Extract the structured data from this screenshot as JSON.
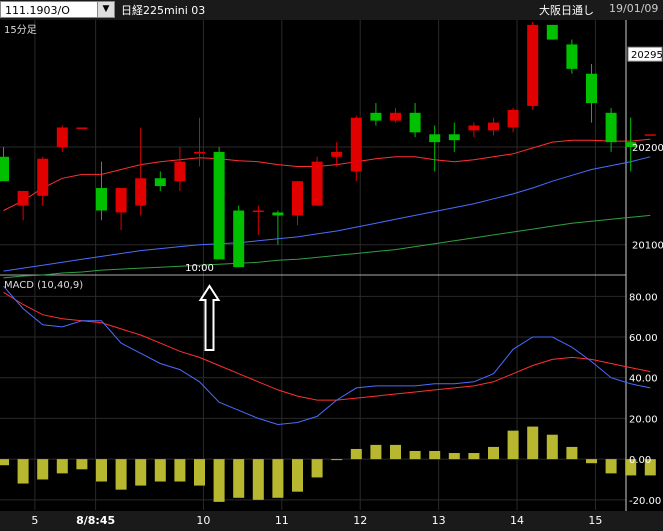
{
  "toolbar": {
    "symbol": "111.1903/O",
    "dropdown_glyph": "▼",
    "contract": "日経225mini 03",
    "market": "大阪日通し",
    "date": "19/01/09"
  },
  "chart_data": [
    {
      "type": "candlestick",
      "title": "15分足",
      "ylim": [
        20070,
        20330
      ],
      "yticks": [
        20100,
        20200
      ],
      "last_price_label": "20295",
      "annotation": {
        "label": "10:00",
        "arrow": "up",
        "candle_index": 10
      },
      "colors": {
        "up": "#e00000",
        "down": "#00c000",
        "ma_short": "#ff3030",
        "ma_mid": "#4a6cff",
        "ma_long": "#30a040"
      },
      "candles": [
        {
          "o": 20190,
          "h": 20200,
          "l": 20165,
          "c": 20165
        },
        {
          "o": 20140,
          "h": 20155,
          "l": 20125,
          "c": 20155
        },
        {
          "o": 20150,
          "h": 20190,
          "l": 20140,
          "c": 20188
        },
        {
          "o": 20200,
          "h": 20222,
          "l": 20195,
          "c": 20220
        },
        {
          "o": 20220,
          "h": 20220,
          "l": 20220,
          "c": 20220
        },
        {
          "o": 20158,
          "h": 20185,
          "l": 20125,
          "c": 20135
        },
        {
          "o": 20133,
          "h": 20155,
          "l": 20115,
          "c": 20158
        },
        {
          "o": 20140,
          "h": 20220,
          "l": 20130,
          "c": 20168
        },
        {
          "o": 20168,
          "h": 20175,
          "l": 20155,
          "c": 20160
        },
        {
          "o": 20165,
          "h": 20200,
          "l": 20155,
          "c": 20185
        },
        {
          "o": 20195,
          "h": 20230,
          "l": 20180,
          "c": 20195
        },
        {
          "o": 20195,
          "h": 20200,
          "l": 20085,
          "c": 20085
        },
        {
          "o": 20135,
          "h": 20140,
          "l": 20080,
          "c": 20077
        },
        {
          "o": 20135,
          "h": 20140,
          "l": 20110,
          "c": 20135
        },
        {
          "o": 20133,
          "h": 20135,
          "l": 20100,
          "c": 20130
        },
        {
          "o": 20130,
          "h": 20165,
          "l": 20120,
          "c": 20165
        },
        {
          "o": 20140,
          "h": 20190,
          "l": 20140,
          "c": 20185
        },
        {
          "o": 20190,
          "h": 20205,
          "l": 20180,
          "c": 20195
        },
        {
          "o": 20175,
          "h": 20232,
          "l": 20165,
          "c": 20230
        },
        {
          "o": 20235,
          "h": 20245,
          "l": 20222,
          "c": 20227
        },
        {
          "o": 20227,
          "h": 20240,
          "l": 20225,
          "c": 20235
        },
        {
          "o": 20235,
          "h": 20245,
          "l": 20210,
          "c": 20215
        },
        {
          "o": 20213,
          "h": 20222,
          "l": 20175,
          "c": 20205
        },
        {
          "o": 20213,
          "h": 20225,
          "l": 20195,
          "c": 20207
        },
        {
          "o": 20217,
          "h": 20225,
          "l": 20210,
          "c": 20222
        },
        {
          "o": 20217,
          "h": 20230,
          "l": 20212,
          "c": 20225
        },
        {
          "o": 20220,
          "h": 20240,
          "l": 20215,
          "c": 20238
        },
        {
          "o": 20242,
          "h": 20328,
          "l": 20238,
          "c": 20325
        },
        {
          "o": 20325,
          "h": 20325,
          "l": 20310,
          "c": 20310
        },
        {
          "o": 20305,
          "h": 20310,
          "l": 20275,
          "c": 20280
        },
        {
          "o": 20275,
          "h": 20285,
          "l": 20225,
          "c": 20245
        },
        {
          "o": 20235,
          "h": 20240,
          "l": 20195,
          "c": 20205
        },
        {
          "o": 20205,
          "h": 20230,
          "l": 20175,
          "c": 20200
        },
        {
          "o": 20213,
          "h": 20213,
          "l": 20213,
          "c": 20213
        }
      ],
      "ma_short": [
        20135,
        20145,
        20158,
        20168,
        20172,
        20172,
        20177,
        20182,
        20185,
        20187,
        20189,
        20188,
        20186,
        20185,
        20182,
        20180,
        20180,
        20182,
        20185,
        20188,
        20190,
        20190,
        20187,
        20185,
        20187,
        20190,
        20193,
        20199,
        20205,
        20207,
        20207,
        20206,
        20206,
        20208
      ],
      "ma_mid": [
        20073,
        20076,
        20079,
        20082,
        20085,
        20088,
        20091,
        20094,
        20096,
        20098,
        20100,
        20101,
        20102,
        20104,
        20106,
        20108,
        20111,
        20114,
        20118,
        20122,
        20126,
        20130,
        20134,
        20138,
        20142,
        20147,
        20152,
        20158,
        20165,
        20171,
        20177,
        20181,
        20185,
        20190
      ],
      "ma_long": [
        20066,
        20068,
        20069,
        20071,
        20072,
        20074,
        20075,
        20076,
        20077,
        20078,
        20079,
        20080,
        20081,
        20082,
        20084,
        20085,
        20087,
        20089,
        20091,
        20093,
        20095,
        20098,
        20101,
        20104,
        20107,
        20110,
        20113,
        20116,
        20119,
        20122,
        20124,
        20126,
        20128,
        20130
      ]
    },
    {
      "type": "macd",
      "title": "MACD (10,40,9)",
      "ylim": [
        -25,
        90
      ],
      "yticks": [
        80,
        60,
        40,
        20,
        0,
        -20
      ],
      "ytick_labels": [
        "80.00",
        "60.00",
        "40.00",
        "20.00",
        "0.00",
        "-20.00"
      ],
      "colors": {
        "macd": "#4a6cff",
        "signal": "#ff3030",
        "histogram": "#b8b830"
      },
      "macd": [
        85,
        74,
        66,
        65,
        68,
        68,
        57,
        52,
        47,
        44,
        38,
        28,
        24,
        20,
        17,
        18,
        21,
        29,
        35,
        36,
        36,
        36,
        37,
        37,
        38,
        42,
        54,
        60,
        60,
        55,
        48,
        40,
        37,
        35
      ],
      "signal": [
        82,
        76,
        71,
        69,
        68,
        67,
        64,
        61,
        57,
        53,
        50,
        46,
        42,
        38,
        34,
        31,
        29,
        29,
        30,
        31,
        32,
        33,
        34,
        35,
        36,
        38,
        42,
        46,
        49,
        50,
        49,
        47,
        45,
        43
      ],
      "histogram": [
        -3,
        -12,
        -10,
        -7,
        -5,
        -11,
        -15,
        -13,
        -11,
        -11,
        -13,
        -21,
        -19,
        -20,
        -19,
        -16,
        -9,
        0,
        5,
        7,
        7,
        4,
        4,
        3,
        3,
        6,
        14,
        16,
        12,
        6,
        -2,
        -7,
        -8,
        -8
      ],
      "xtick_labels": [
        {
          "i": 1.6,
          "label": "5"
        },
        {
          "i": 4.7,
          "label": "8/8:45"
        },
        {
          "i": 10.2,
          "label": "10"
        },
        {
          "i": 14.2,
          "label": "11"
        },
        {
          "i": 18.2,
          "label": "12"
        },
        {
          "i": 22.2,
          "label": "13"
        },
        {
          "i": 26.2,
          "label": "14"
        },
        {
          "i": 30.2,
          "label": "15"
        }
      ]
    }
  ]
}
